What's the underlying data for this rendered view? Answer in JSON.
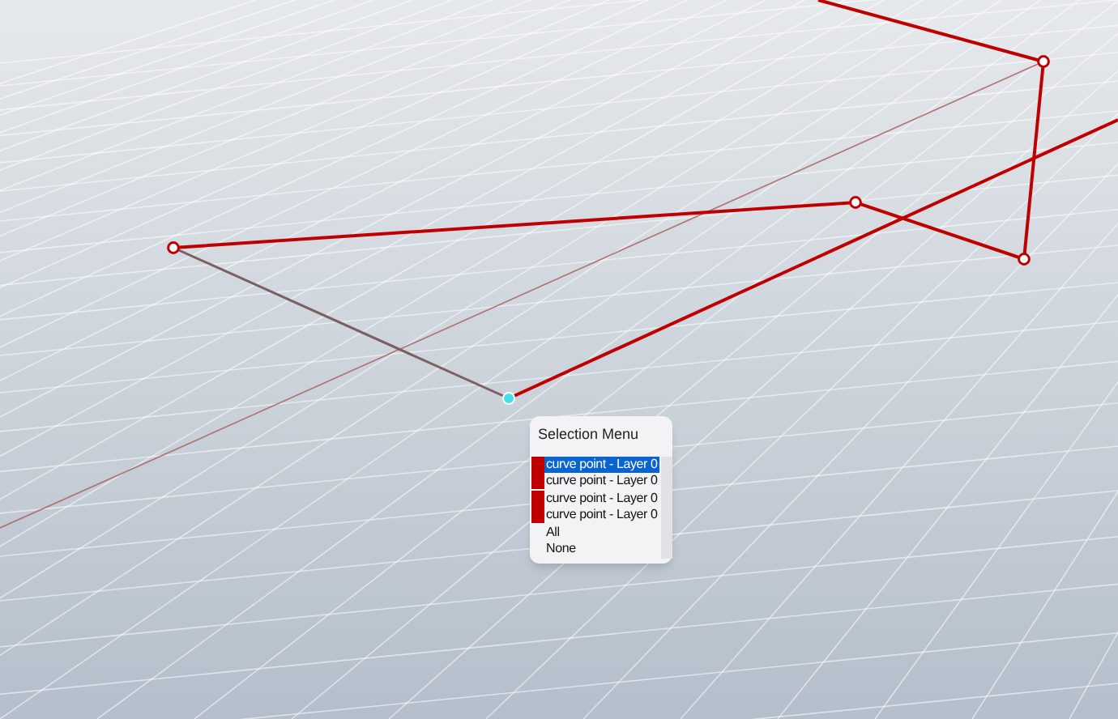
{
  "selection_menu": {
    "title": "Selection Menu",
    "items": [
      {
        "label": "curve point - Layer 0",
        "kind": "object",
        "color": "#c00000",
        "selected": true
      },
      {
        "label": "curve point - Layer 0",
        "kind": "object",
        "color": "#c00000",
        "selected": false
      },
      {
        "label": "curve point - Layer 0",
        "kind": "object",
        "color": "#c00000",
        "selected": false
      },
      {
        "label": "curve point - Layer 0",
        "kind": "object",
        "color": "#c00000",
        "selected": false
      },
      {
        "label": "All",
        "kind": "command",
        "selected": false
      },
      {
        "label": "None",
        "kind": "command",
        "selected": false
      }
    ]
  }
}
